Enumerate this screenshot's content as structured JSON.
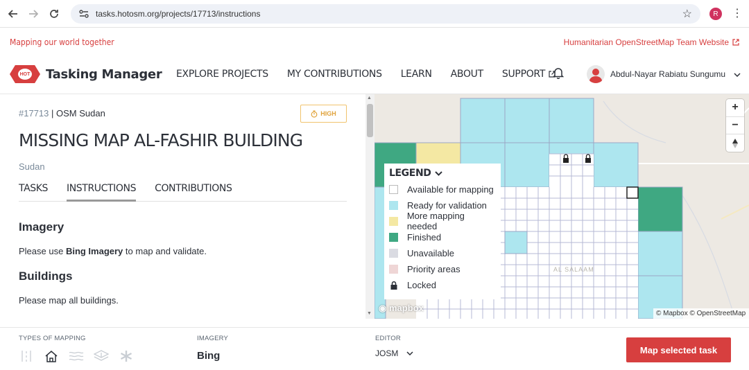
{
  "browser": {
    "url": "tasks.hotosm.org/projects/17713/instructions",
    "profile_initial": "R"
  },
  "top_strip": {
    "tagline": "Mapping our world together",
    "external_link": "Humanitarian OpenStreetMap Team Website"
  },
  "nav": {
    "logo_mark": "HOT",
    "logo_text": "Tasking Manager",
    "links": [
      "EXPLORE PROJECTS",
      "MY CONTRIBUTIONS",
      "LEARN",
      "ABOUT",
      "SUPPORT"
    ],
    "user_name": "Abdul-Nayar Rabiatu Sungumu"
  },
  "project": {
    "id": "#17713",
    "org": "| OSM Sudan",
    "priority": "HIGH",
    "title": "MISSING MAP AL-FASHIR BUILDING",
    "country": "Sudan",
    "tabs": [
      "TASKS",
      "INSTRUCTIONS",
      "CONTRIBUTIONS"
    ],
    "active_tab": "INSTRUCTIONS"
  },
  "instructions": {
    "imagery_heading": "Imagery",
    "imagery_pre": "Please use ",
    "imagery_bold": "Bing Imagery",
    "imagery_post": " to map and validate.",
    "buildings_heading": "Buildings",
    "buildings_text": "Please map all buildings."
  },
  "map": {
    "legend_title": "LEGEND",
    "legend_items": [
      {
        "label": "Available for mapping",
        "color": "#ffffff",
        "border": "#bbbbbb"
      },
      {
        "label": "Ready for validation",
        "color": "#ade6ef"
      },
      {
        "label": "More mapping needed",
        "color": "#f4e8a3"
      },
      {
        "label": "Finished",
        "color": "#3fa882"
      },
      {
        "label": "Unavailable",
        "color": "#dadbe2"
      },
      {
        "label": "Priority areas",
        "color": "#efd6d6"
      },
      {
        "label": "Locked",
        "color": "lock"
      }
    ],
    "place_label": "AL SALAAM",
    "mapbox_logo": "mapbox",
    "attribution": "© Mapbox © OpenStreetMap"
  },
  "bottom": {
    "types_label": "TYPES OF MAPPING",
    "imagery_label": "IMAGERY",
    "imagery_value": "Bing",
    "editor_label": "EDITOR",
    "editor_value": "JOSM",
    "cta": "Map selected task",
    "mapping_types": [
      {
        "icon": "roads-icon",
        "active": false
      },
      {
        "icon": "buildings-icon",
        "active": true
      },
      {
        "icon": "waterways-icon",
        "active": false
      },
      {
        "icon": "landuse-icon",
        "active": false
      },
      {
        "icon": "other-icon",
        "active": false
      }
    ]
  }
}
